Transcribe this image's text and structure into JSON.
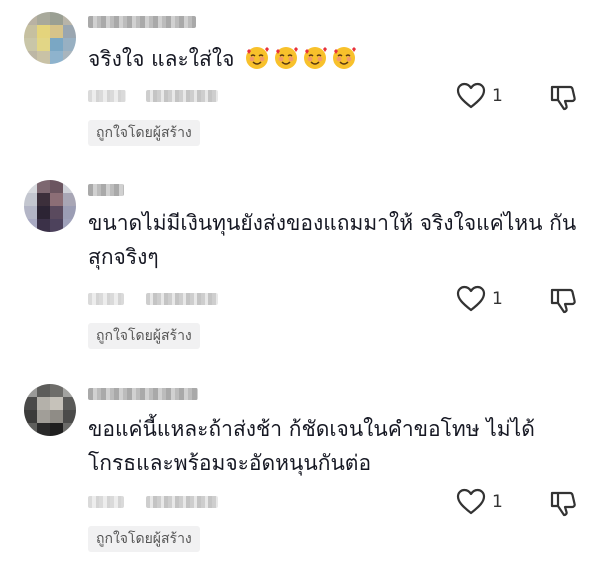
{
  "comments": [
    {
      "text": "จริงใจ และใส่ใจ",
      "emoji_count": 4,
      "likes": "1",
      "badge": "ถูกใจโดยผู้สร้าง"
    },
    {
      "text": "ขนาดไม่มีเงินทุนยังส่งของแถมมาให้ จริงใจแค่ไหน กัน สุกจริงๆ",
      "likes": "1",
      "badge": "ถูกใจโดยผู้สร้าง"
    },
    {
      "text": "ขอแค่นี้แหละถ้าส่งช้า ก้ชัดเจนในคำขอโทษ ไม่ได้ โกรธและพร้อมจะอัดหนุนกันต่อ",
      "likes": "1",
      "badge": "ถูกใจโดยผู้สร้าง"
    }
  ],
  "icons": {
    "like": "heart-outline-icon",
    "dislike": "thumbs-down-outline-icon",
    "emoji": "smiling-face-with-hearts-emoji"
  }
}
